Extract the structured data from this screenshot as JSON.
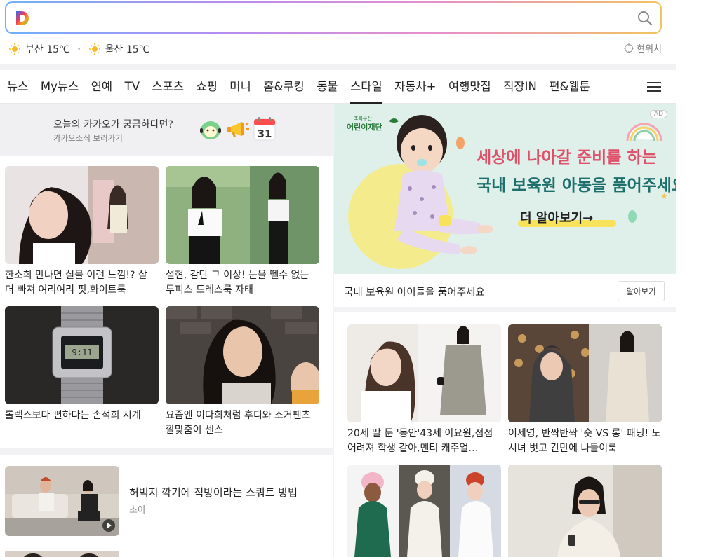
{
  "search": {
    "placeholder": ""
  },
  "weather": [
    {
      "city": "부산 15℃"
    },
    {
      "city": "울산 15℃"
    }
  ],
  "location_label": "현위치",
  "nav": [
    "뉴스",
    "My뉴스",
    "연예",
    "TV",
    "스포츠",
    "쇼핑",
    "머니",
    "홈&쿠킹",
    "동물",
    "스타일",
    "자동차+",
    "여행맛집",
    "직장IN",
    "펀&웹툰"
  ],
  "nav_active": "스타일",
  "kakao": {
    "title": "오늘의 카카오가 궁금하다면?",
    "subtitle": "카카오소식 보러가기",
    "calendar_day": "31"
  },
  "left_tiles": [
    {
      "title": "한소희 만나면 실물 이런 느낌!? 살 더 빠져 여리여리 핏,화이트룩"
    },
    {
      "title": "설현, 감탄 그 이상! 눈을 뗄수 없는 투피스 드레스룩 자태"
    },
    {
      "title": "롤렉스보다 편하다는 손석희 시계"
    },
    {
      "title": "요즘엔 이다희처럼 후디와 조거팬츠 깔맞춤이 센스"
    }
  ],
  "video_row": {
    "title": "허벅지 깍기에 직방이라는 스쿼트 방법",
    "source": "초아"
  },
  "ad": {
    "badge": "AD",
    "org": "어린이재단",
    "org_sub": "초록우산",
    "line1": "세상에 나아갈 준비를 하는",
    "line2": "국내 보육원 아동을 품어주세요",
    "cta": "더 알아보기→",
    "caption": "국내 보육원 아이들을 품어주세요",
    "button": "알아보기"
  },
  "right_tiles": [
    {
      "title": "20세 딸 둔 '동안'43세 이요원,점점 어려져 학생 같아,멘티 캐주얼…"
    },
    {
      "title": "이세영, 반짝반짝 '숏 VS 롱' 패딩! 도시녀 벗고 간만에 나들이룩"
    }
  ],
  "colors": {
    "accent": "#222222",
    "kakao_yellow": "#f7c72d"
  }
}
